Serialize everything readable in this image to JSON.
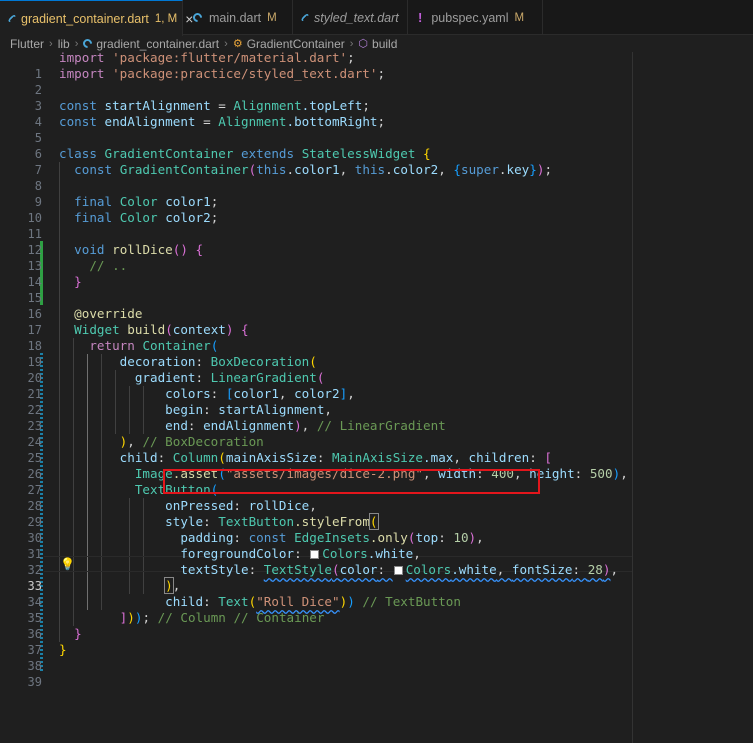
{
  "tabs": [
    {
      "label": "gradient_container.dart",
      "badge": "1, M",
      "close": "×",
      "active": true
    },
    {
      "label": "main.dart",
      "badge": "M",
      "active": false
    },
    {
      "label": "styled_text.dart",
      "badge": "",
      "active": false
    },
    {
      "label": "pubspec.yaml",
      "badge": "M",
      "icon": "!",
      "active": false
    }
  ],
  "breadcrumb": {
    "items": [
      "Flutter",
      "lib",
      "gradient_container.dart",
      "GradientContainer",
      "build"
    ],
    "separator": "›"
  },
  "editor": {
    "current_line": 33,
    "line_numbers": [
      "1",
      "2",
      "3",
      "4",
      "5",
      "6",
      "7",
      "8",
      "9",
      "10",
      "11",
      "12",
      "13",
      "14",
      "15",
      "16",
      "17",
      "18",
      "19",
      "20",
      "21",
      "22",
      "23",
      "24",
      "25",
      "26",
      "27",
      "28",
      "29",
      "30",
      "31",
      "32",
      "33",
      "34",
      "35",
      "36",
      "37",
      "38",
      "39"
    ],
    "lightbulb_icon": "lightbulb-icon",
    "highlight_color": "#e3161c",
    "tokens": {
      "import": "import",
      "pkg_material": "'package:flutter/material.dart'",
      "pkg_styled": "'package:practice/styled_text.dart'",
      "semi": ";",
      "const": "const",
      "startAlignment": "startAlignment",
      "endAlignment": "endAlignment",
      "eq": " = ",
      "Alignment": "Alignment",
      "topLeft": ".topLeft",
      "bottomRight": ".bottomRight",
      "class": "class",
      "GradientContainer": "GradientContainer",
      "extends": "extends",
      "StatelessWidget": "StatelessWidget",
      "brace_open": "{",
      "brace_close": "}",
      "paren_open": "(",
      "paren_close": ")",
      "this": "this",
      "color1": "color1",
      "color2": "color2",
      "super": "super",
      "key": "key",
      "final": "final",
      "Color": "Color",
      "void": "void",
      "rollDice": "rollDice",
      "comment_dots": "// ..",
      "override": "@override",
      "Widget": "Widget",
      "build": "build",
      "context": "context",
      "return": "return",
      "Container": "Container",
      "decoration": "decoration",
      "BoxDecoration": "BoxDecoration",
      "gradient": "gradient",
      "LinearGradient": "LinearGradient",
      "colors": "colors",
      "begin": "begin",
      "end": "end",
      "comment_lineargradient": "// LinearGradient",
      "comment_boxdecoration": "// BoxDecoration",
      "child": "child",
      "Column": "Column",
      "mainAxisSize": "mainAxisSize",
      "MainAxisSize": "MainAxisSize",
      "max": ".max",
      "children": "children",
      "Image": "Image",
      "asset": ".asset",
      "asset_path": "\"assets/images/dice-2.png\"",
      "width": "width",
      "height": "height",
      "n400": "400",
      "n500": "500",
      "TextButton": "TextButton",
      "onPressed": "onPressed",
      "style": "style",
      "styleFrom": ".styleFrom",
      "padding": "padding",
      "EdgeInsets": "EdgeInsets",
      "only": ".only",
      "top": "top",
      "n10": "10",
      "foregroundColor": "foregroundColor",
      "Colors": "Colors",
      "white": ".white",
      "textStyle": "textStyle",
      "TextStyle": "TextStyle",
      "color": "color",
      "fontSize": "fontSize",
      "n28": "28",
      "Text": "Text",
      "roll_dice": "\"Roll Dice\"",
      "comment_textbutton": "// TextButton",
      "comment_column_container": "// Column // Container"
    }
  }
}
